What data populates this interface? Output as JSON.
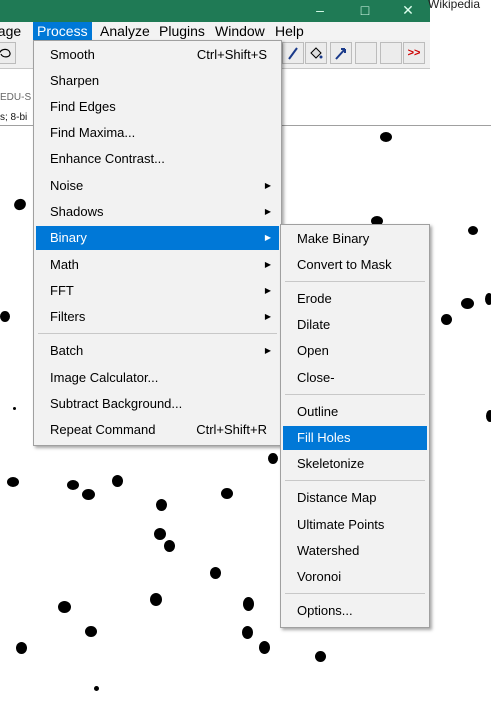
{
  "window": {
    "bg_text": "Wikipedia"
  },
  "menubar": {
    "items": [
      {
        "label": "nage"
      },
      {
        "label": "Process",
        "active": true
      },
      {
        "label": "Analyze"
      },
      {
        "label": "Plugins"
      },
      {
        "label": "Window"
      },
      {
        "label": "Help"
      }
    ]
  },
  "toolbar": {
    "more_label": ">>"
  },
  "image_window": {
    "title_fragment": "EDU-S",
    "info_fragment": "s; 8-bi"
  },
  "process_menu": {
    "items": [
      {
        "label": "Smooth",
        "shortcut": "Ctrl+Shift+S"
      },
      {
        "label": "Sharpen"
      },
      {
        "label": "Find Edges"
      },
      {
        "label": "Find Maxima..."
      },
      {
        "label": "Enhance Contrast..."
      },
      {
        "label": "Noise",
        "submenu": true
      },
      {
        "label": "Shadows",
        "submenu": true
      },
      {
        "label": "Binary",
        "submenu": true,
        "highlighted": true
      },
      {
        "label": "Math",
        "submenu": true
      },
      {
        "label": "FFT",
        "submenu": true
      },
      {
        "label": "Filters",
        "submenu": true
      },
      {
        "label": "Batch",
        "submenu": true
      },
      {
        "label": "Image Calculator..."
      },
      {
        "label": "Subtract Background..."
      },
      {
        "label": "Repeat Command",
        "shortcut": "Ctrl+Shift+R"
      }
    ]
  },
  "binary_menu": {
    "items": [
      {
        "label": "Make Binary"
      },
      {
        "label": "Convert to Mask"
      },
      {
        "label": "Erode"
      },
      {
        "label": "Dilate"
      },
      {
        "label": "Open"
      },
      {
        "label": "Close-"
      },
      {
        "label": "Outline"
      },
      {
        "label": "Fill Holes",
        "highlighted": true
      },
      {
        "label": "Skeletonize"
      },
      {
        "label": "Distance Map"
      },
      {
        "label": "Ultimate Points"
      },
      {
        "label": "Watershed"
      },
      {
        "label": "Voronoi"
      },
      {
        "label": "Options..."
      }
    ]
  },
  "colors": {
    "accent": "#0078d7",
    "title_bar": "#1f7a55"
  },
  "icons": [
    "minimize-icon",
    "maximize-icon",
    "close-icon",
    "submenu-arrow-icon"
  ]
}
